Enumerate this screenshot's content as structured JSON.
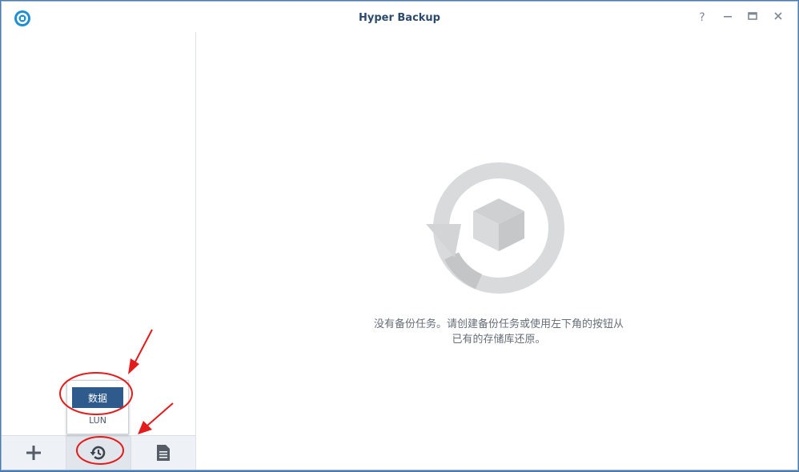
{
  "window": {
    "title": "Hyper Backup",
    "controls": {
      "help": "?",
      "minimize": "—",
      "maximize": "▭",
      "close": "✕"
    }
  },
  "popup_menu": {
    "items": [
      {
        "label": "数据",
        "selected": true
      },
      {
        "label": "LUN",
        "selected": false
      }
    ]
  },
  "sidebar_toolbar": {
    "buttons": [
      {
        "icon": "plus-icon"
      },
      {
        "icon": "restore-history-icon"
      },
      {
        "icon": "log-document-icon"
      }
    ]
  },
  "main": {
    "empty_message_line1": "没有备份任务。请创建备份任务或使用左下角的按钮从",
    "empty_message_line2": "已有的存储库还原。"
  },
  "colors": {
    "accent": "#2f5a8c",
    "annotation": "#e41b1b",
    "illustration_gray": "#d9dadc"
  }
}
